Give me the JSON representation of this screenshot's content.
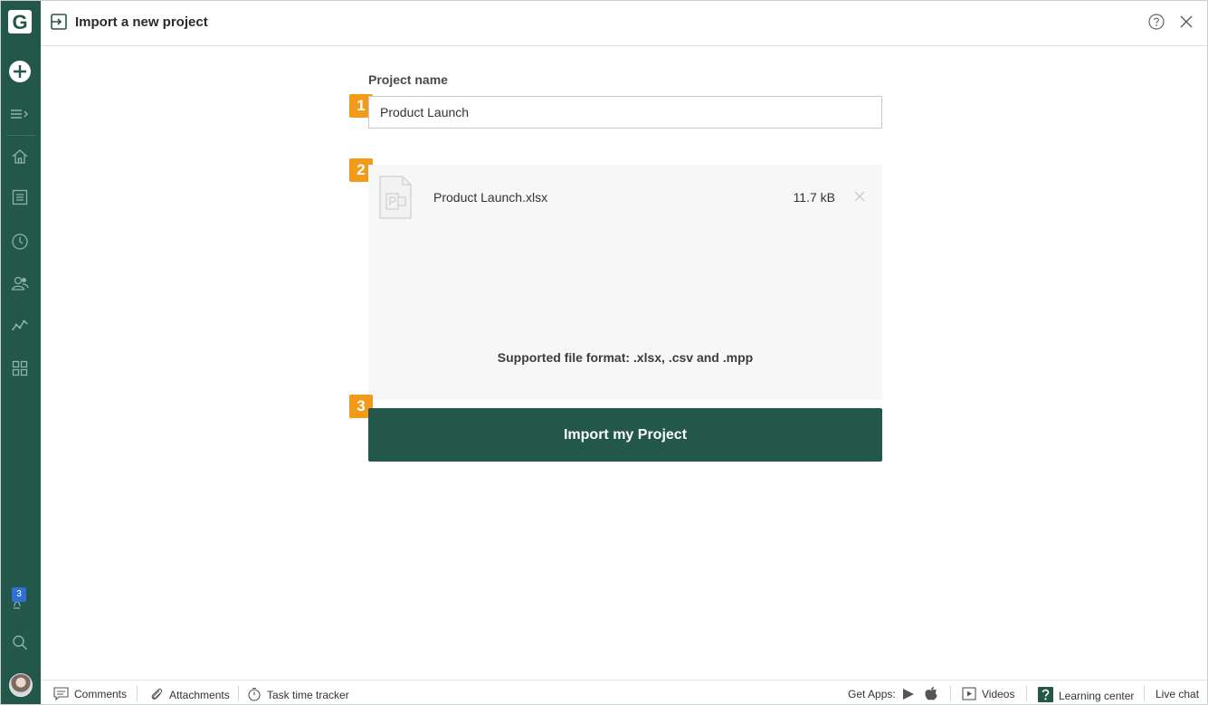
{
  "header": {
    "title": "Import a new project"
  },
  "sidebar": {
    "logo_letter": "G",
    "notifications_count": "3",
    "icons": [
      "logo-icon",
      "add-icon",
      "expand-menu-icon",
      "home-icon",
      "list-icon",
      "clock-icon",
      "users-icon",
      "chart-line-icon",
      "apps-grid-icon",
      "notifications-icon",
      "search-icon",
      "avatar"
    ]
  },
  "form": {
    "project_name_label": "Project name",
    "project_name_value": "Product Launch",
    "steps": [
      "1",
      "2",
      "3"
    ],
    "file": {
      "name": "Product Launch.xlsx",
      "size": "11.7 kB"
    },
    "supported_formats": "Supported file format: .xlsx, .csv and .mpp",
    "import_button": "Import my Project"
  },
  "footer": {
    "comments": "Comments",
    "attachments": "Attachments",
    "task_time_tracker": "Task time tracker",
    "get_apps": "Get Apps:",
    "videos": "Videos",
    "learning_center": "Learning center",
    "live_chat": "Live chat"
  },
  "colors": {
    "brand_green": "#23574a",
    "step_orange": "#f39a1b",
    "badge_blue": "#2f6fd6"
  }
}
